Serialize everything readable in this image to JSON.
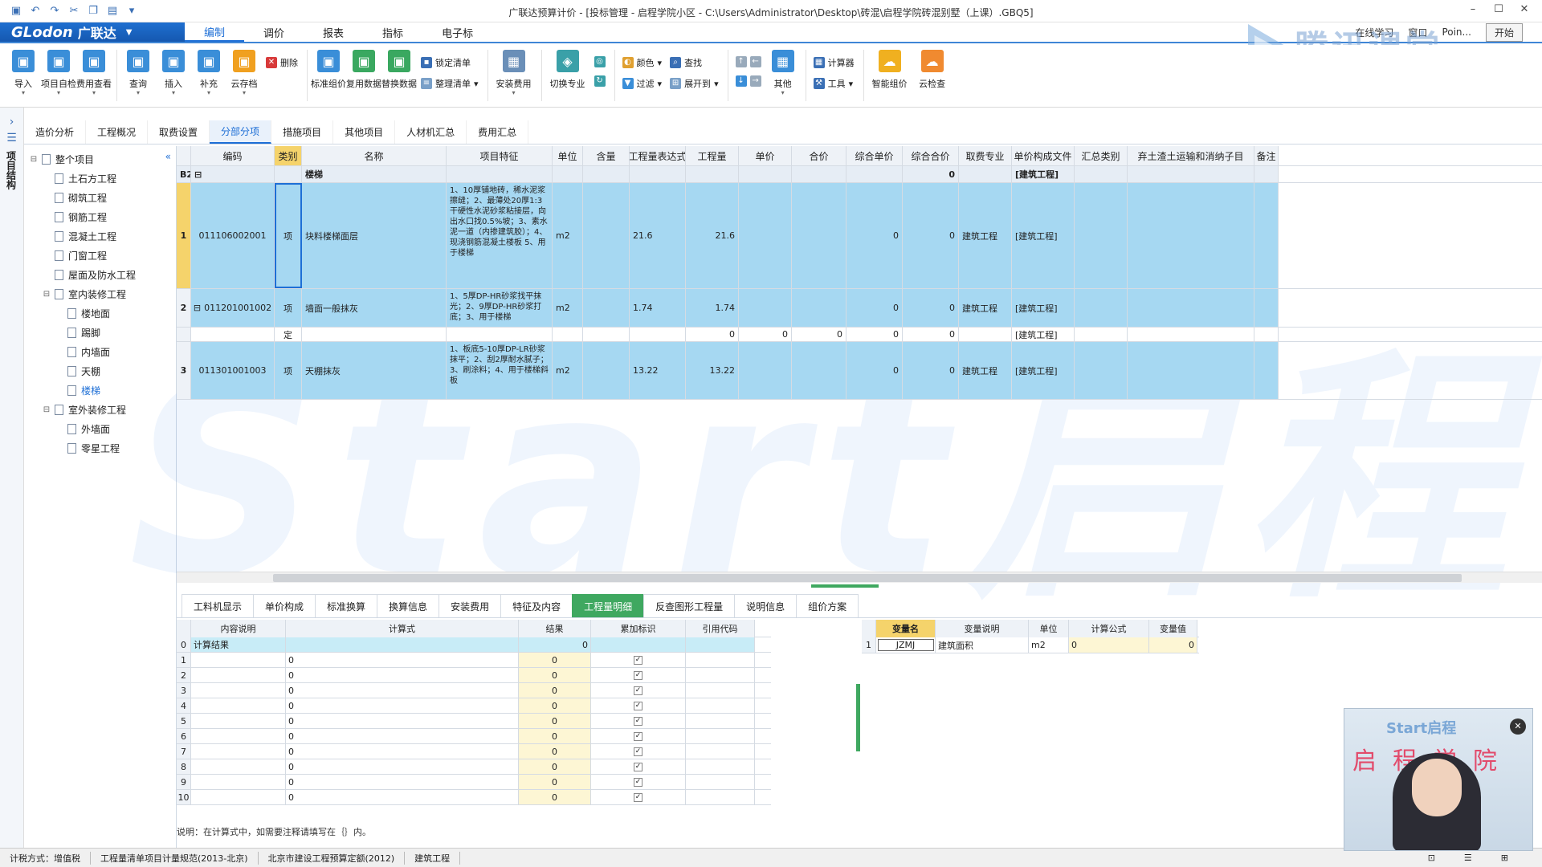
{
  "window": {
    "title": "广联达预算计价 - [投标管理 - 启程学院小区 - C:\\Users\\Administrator\\Desktop\\砖混\\启程学院砖混别墅（上课）.GBQ5]",
    "point_label": "Poin...",
    "start_label": "开始"
  },
  "menubar": {
    "logo": "GLodon",
    "logo_cn": "广联达",
    "items": [
      {
        "label": "编制",
        "active": true
      },
      {
        "label": "调价"
      },
      {
        "label": "报表"
      },
      {
        "label": "指标"
      },
      {
        "label": "电子标"
      }
    ],
    "right": {
      "study": "在线学习",
      "window": "窗口"
    }
  },
  "ribbon": {
    "buttons1": [
      {
        "label": "导入",
        "color": "#3a8ed8"
      },
      {
        "label": "项目自检",
        "color": "#3a8ed8"
      },
      {
        "label": "费用查看",
        "color": "#3a8ed8"
      }
    ],
    "buttons2": [
      {
        "label": "查询",
        "color": "#3a8ed8"
      },
      {
        "label": "插入",
        "color": "#3a8ed8"
      },
      {
        "label": "补充",
        "color": "#3a8ed8"
      },
      {
        "label": "云存档",
        "color": "#f0a020"
      }
    ],
    "delete_label": "删除",
    "buttons3": [
      {
        "label": "标准组价",
        "color": "#3a8ed8"
      },
      {
        "label": "复用数据",
        "color": "#3aa860"
      },
      {
        "label": "替换数据",
        "color": "#3aa860"
      }
    ],
    "lock_label": "锁定清单",
    "arrange_label": "整理清单",
    "install_label": "安装费用",
    "switch_label": "切换专业",
    "color_label": "颜色",
    "find_label": "查找",
    "filter_label": "过滤",
    "expand_label": "展开到",
    "other_label": "其他",
    "calculator_label": "计算器",
    "tools_label": "工具",
    "smart_label": "智能组价",
    "cloud_check_label": "云检查"
  },
  "leftstrip": {
    "label": "项目结构"
  },
  "tabs": [
    {
      "label": "造价分析"
    },
    {
      "label": "工程概况"
    },
    {
      "label": "取费设置"
    },
    {
      "label": "分部分项",
      "active": true
    },
    {
      "label": "措施项目"
    },
    {
      "label": "其他项目"
    },
    {
      "label": "人材机汇总"
    },
    {
      "label": "费用汇总"
    }
  ],
  "tree": [
    {
      "label": "整个项目",
      "level": 0,
      "toggle": "⊟"
    },
    {
      "label": "土石方工程",
      "level": 1
    },
    {
      "label": "砌筑工程",
      "level": 1
    },
    {
      "label": "钢筋工程",
      "level": 1
    },
    {
      "label": "混凝土工程",
      "level": 1
    },
    {
      "label": "门窗工程",
      "level": 1
    },
    {
      "label": "屋面及防水工程",
      "level": 1
    },
    {
      "label": "室内装修工程",
      "level": 1,
      "toggle": "⊟"
    },
    {
      "label": "楼地面",
      "level": 2
    },
    {
      "label": "踢脚",
      "level": 2
    },
    {
      "label": "内墙面",
      "level": 2
    },
    {
      "label": "天棚",
      "level": 2
    },
    {
      "label": "楼梯",
      "level": 2,
      "selected": true
    },
    {
      "label": "室外装修工程",
      "level": 1,
      "toggle": "⊟"
    },
    {
      "label": "外墙面",
      "level": 2
    },
    {
      "label": "零星工程",
      "level": 2
    }
  ],
  "grid": {
    "headers": [
      "",
      "编码",
      "类别",
      "名称",
      "项目特征",
      "单位",
      "含量",
      "工程量表达式",
      "工程量",
      "单价",
      "合价",
      "综合单价",
      "综合合价",
      "取费专业",
      "单价构成文件",
      "汇总类别",
      "弃土渣土运输和消纳子目",
      "备注"
    ],
    "section": {
      "code": "B2",
      "toggle": "⊟",
      "name": "楼梯",
      "total": "0",
      "file": "[建筑工程]"
    },
    "rows": [
      {
        "rn": "1",
        "code": "011106002001",
        "type": "项",
        "name": "块料楼梯面层",
        "feature": "1、10厚铺地砖，稀水泥浆擦缝；2、最薄处20厚1:3干硬性水泥砂浆粘接层，向出水口找0.5%坡；3、素水泥一道（内掺建筑胶）；4、现浇钢筋混凝土楼板 5、用于楼梯",
        "unit": "m2",
        "content": "",
        "expr": "21.6",
        "qty": "21.6",
        "price": "",
        "total": "",
        "uprice": "0",
        "utotal": "0",
        "prof": "建筑工程",
        "file": "[建筑工程]",
        "style": "blue",
        "selected": true
      },
      {
        "rn": "2",
        "toggle": "⊟",
        "code": "011201001002",
        "type": "项",
        "name": "墙面一般抹灰",
        "feature": "1、5厚DP-HR砂浆找平抹光；2、9厚DP-HR砂浆打底；3、用于楼梯",
        "unit": "m2",
        "content": "",
        "expr": "1.74",
        "qty": "1.74",
        "price": "",
        "total": "",
        "uprice": "0",
        "utotal": "0",
        "prof": "建筑工程",
        "file": "[建筑工程]",
        "style": "blue"
      },
      {
        "rn": "",
        "code": "",
        "type": "定",
        "name": "",
        "feature": "",
        "unit": "",
        "content": "",
        "expr": "",
        "qty": "0",
        "price": "0",
        "total": "0",
        "uprice": "0",
        "utotal": "0",
        "prof": "",
        "file": "[建筑工程]",
        "style": "light"
      },
      {
        "rn": "3",
        "code": "011301001003",
        "type": "项",
        "name": "天棚抹灰",
        "feature": "1、板底5-10厚DP-LR砂浆抹平；2、刮2厚耐水腻子；3、刷涂料；4、用于楼梯斜板",
        "unit": "m2",
        "content": "",
        "expr": "13.22",
        "qty": "13.22",
        "price": "",
        "total": "",
        "uprice": "0",
        "utotal": "0",
        "prof": "建筑工程",
        "file": "[建筑工程]",
        "style": "blue"
      }
    ]
  },
  "bottom_tabs": [
    {
      "label": "工料机显示"
    },
    {
      "label": "单价构成"
    },
    {
      "label": "标准换算"
    },
    {
      "label": "换算信息"
    },
    {
      "label": "安装费用"
    },
    {
      "label": "特征及内容"
    },
    {
      "label": "工程量明细",
      "active": true
    },
    {
      "label": "反查图形工程量"
    },
    {
      "label": "说明信息"
    },
    {
      "label": "组价方案"
    }
  ],
  "calc": {
    "headers": [
      "",
      "内容说明",
      "计算式",
      "结果",
      "累加标识",
      "引用代码"
    ],
    "first": {
      "rn": "0",
      "desc": "计算结果",
      "result": "0"
    },
    "rows": [
      {
        "rn": "1",
        "expr": "0",
        "result": "0"
      },
      {
        "rn": "2",
        "expr": "0",
        "result": "0"
      },
      {
        "rn": "3",
        "expr": "0",
        "result": "0"
      },
      {
        "rn": "4",
        "expr": "0",
        "result": "0"
      },
      {
        "rn": "5",
        "expr": "0",
        "result": "0"
      },
      {
        "rn": "6",
        "expr": "0",
        "result": "0"
      },
      {
        "rn": "7",
        "expr": "0",
        "result": "0"
      },
      {
        "rn": "8",
        "expr": "0",
        "result": "0"
      },
      {
        "rn": "9",
        "expr": "0",
        "result": "0"
      },
      {
        "rn": "10",
        "expr": "0",
        "result": "0"
      }
    ],
    "check": "✓"
  },
  "vars": {
    "headers": [
      "",
      "变量名",
      "变量说明",
      "单位",
      "计算公式",
      "变量值"
    ],
    "rows": [
      {
        "rn": "1",
        "name": "JZMJ",
        "desc": "建筑面积",
        "unit": "m2",
        "formula": "0",
        "value": "0"
      }
    ]
  },
  "note": "说明：在计算式中，如需要注释请填写在｛｝内。",
  "status": [
    "计税方式：增值税",
    "工程量清单项目计量规范(2013-北京)",
    "北京市建设工程预算定额(2012)",
    "建筑工程"
  ],
  "video": {
    "title": "Start启程",
    "sub": "启程学院",
    "close": "✕"
  },
  "watermark": {
    "text": "腾讯课堂",
    "big": "Start启程"
  }
}
